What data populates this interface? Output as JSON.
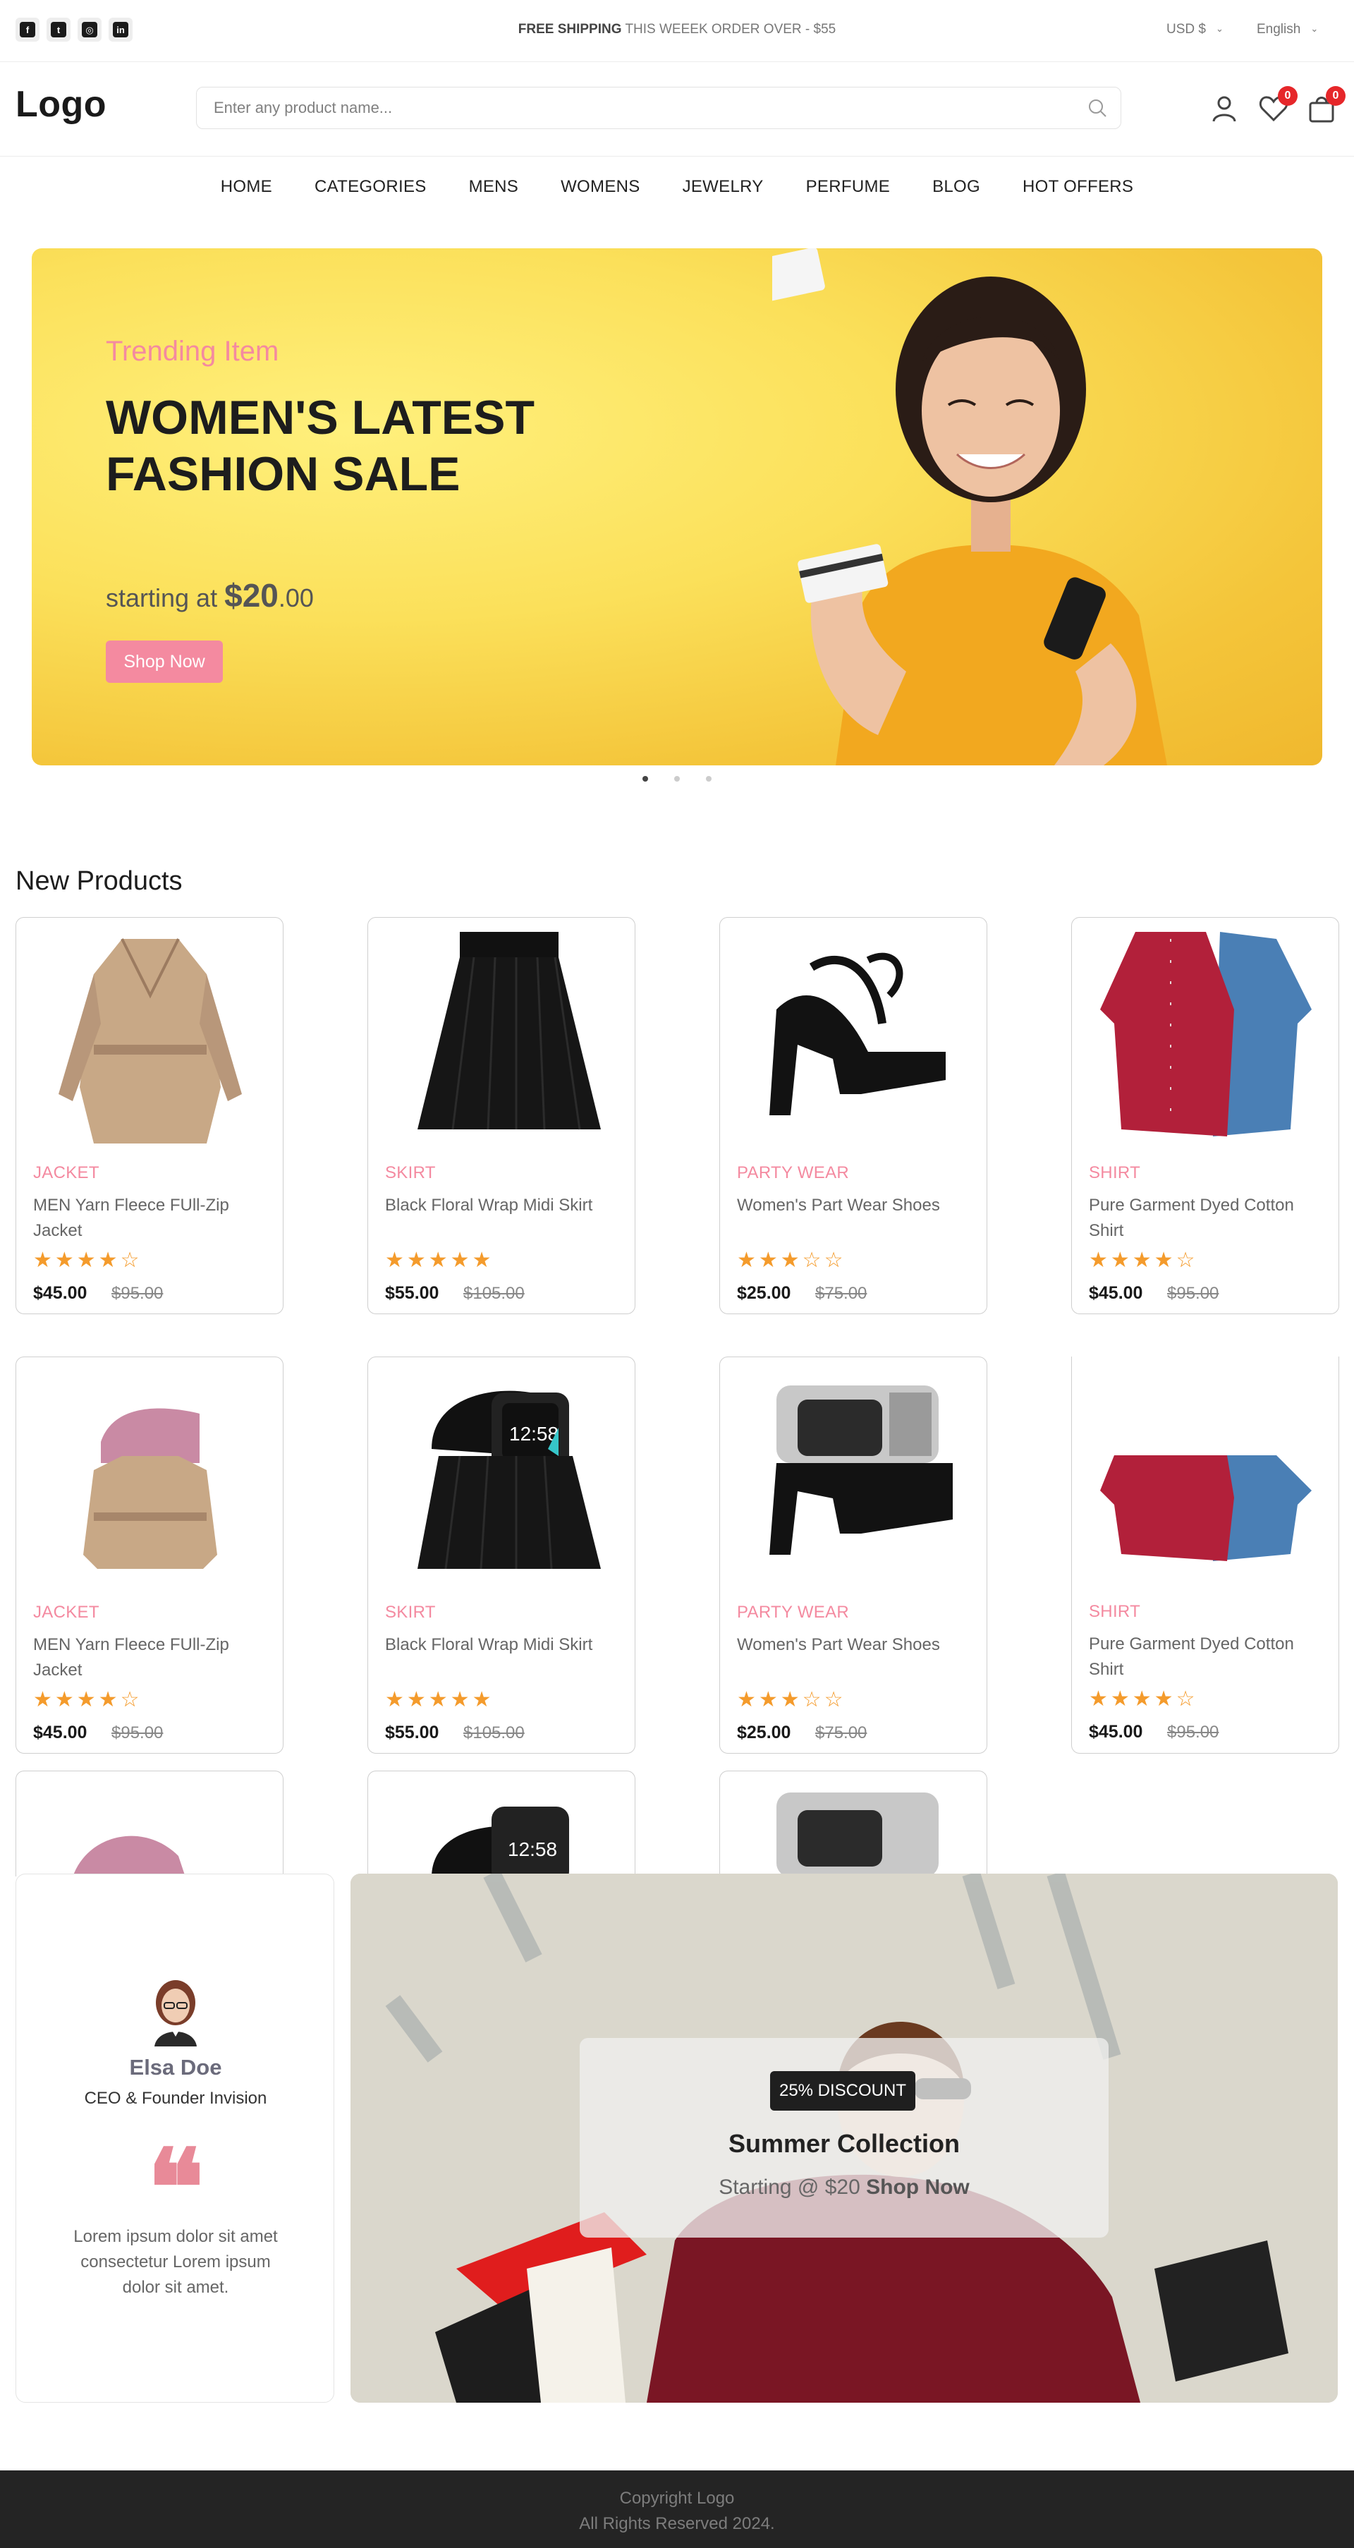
{
  "topbar": {
    "social": [
      {
        "name": "facebook-icon",
        "glyph": "f"
      },
      {
        "name": "twitter-icon",
        "glyph": "t"
      },
      {
        "name": "instagram-icon",
        "glyph": "◎"
      },
      {
        "name": "linkedin-icon",
        "glyph": "in"
      }
    ],
    "shipping_bold": "FREE SHIPPING",
    "shipping_text": "THIS WEEEK ORDER OVER - $55",
    "currency": "USD $",
    "language": "English"
  },
  "header": {
    "logo": "Logo",
    "search_placeholder": "Enter any product name...",
    "wishlist_count": "0",
    "cart_count": "0"
  },
  "nav": [
    "HOME",
    "CATEGORIES",
    "MENS",
    "WOMENS",
    "JEWELRY",
    "PERFUME",
    "BLOG",
    "HOT OFFERS"
  ],
  "hero": {
    "subtitle": "Trending Item",
    "title": "WOMEN'S LATEST FASHION SALE",
    "price_prefix": "starting at",
    "price_main": "$20",
    "price_cents": ".00",
    "button": "Shop Now"
  },
  "products": {
    "title": "New Products",
    "items": [
      {
        "category": "JACKET",
        "name": "MEN Yarn Fleece FUll-Zip Jacket",
        "stars": "★★★★☆",
        "price": "$45.00",
        "old_price": "$95.00"
      },
      {
        "category": "SKIRT",
        "name": "Black Floral Wrap Midi Skirt",
        "stars": "★★★★★",
        "price": "$55.00",
        "old_price": "$105.00"
      },
      {
        "category": "PARTY WEAR",
        "name": "Women's Part Wear Shoes",
        "stars": "★★★☆☆",
        "price": "$25.00",
        "old_price": "$75.00"
      },
      {
        "category": "SHIRT",
        "name": "Pure Garment Dyed Cotton Shirt",
        "stars": "★★★★☆",
        "price": "$45.00",
        "old_price": "$95.00"
      },
      {
        "category": "JACKET",
        "name": "MEN Yarn Fleece FUll-Zip Jacket",
        "stars": "★★★★☆",
        "price": "$45.00",
        "old_price": "$95.00"
      },
      {
        "category": "SKIRT",
        "name": "Black Floral Wrap Midi Skirt",
        "stars": "★★★★★",
        "price": "$55.00",
        "old_price": "$105.00"
      },
      {
        "category": "PARTY WEAR",
        "name": "Women's Part Wear Shoes",
        "stars": "★★★☆☆",
        "price": "$25.00",
        "old_price": "$75.00"
      },
      {
        "category": "SHIRT",
        "name": "Pure Garment Dyed Cotton Shirt",
        "stars": "★★★★☆",
        "price": "$45.00",
        "old_price": "$95.00"
      }
    ]
  },
  "testimonial": {
    "name": "Elsa Doe",
    "role": "CEO & Founder Invision",
    "quote_mark": "❝",
    "text": "Lorem ipsum dolor sit amet consectetur Lorem ipsum dolor sit amet."
  },
  "banner": {
    "discount": "25% DISCOUNT",
    "title": "Summer Collection",
    "start_text": "Starting @ $20",
    "link": "Shop Now"
  },
  "footer": {
    "line1": "Copyright Logo",
    "line2": "All Rights Reserved 2024."
  },
  "colors": {
    "accent": "#f48aa0",
    "star": "#f49b2c",
    "badge": "#e6272a",
    "footer": "#242424"
  }
}
